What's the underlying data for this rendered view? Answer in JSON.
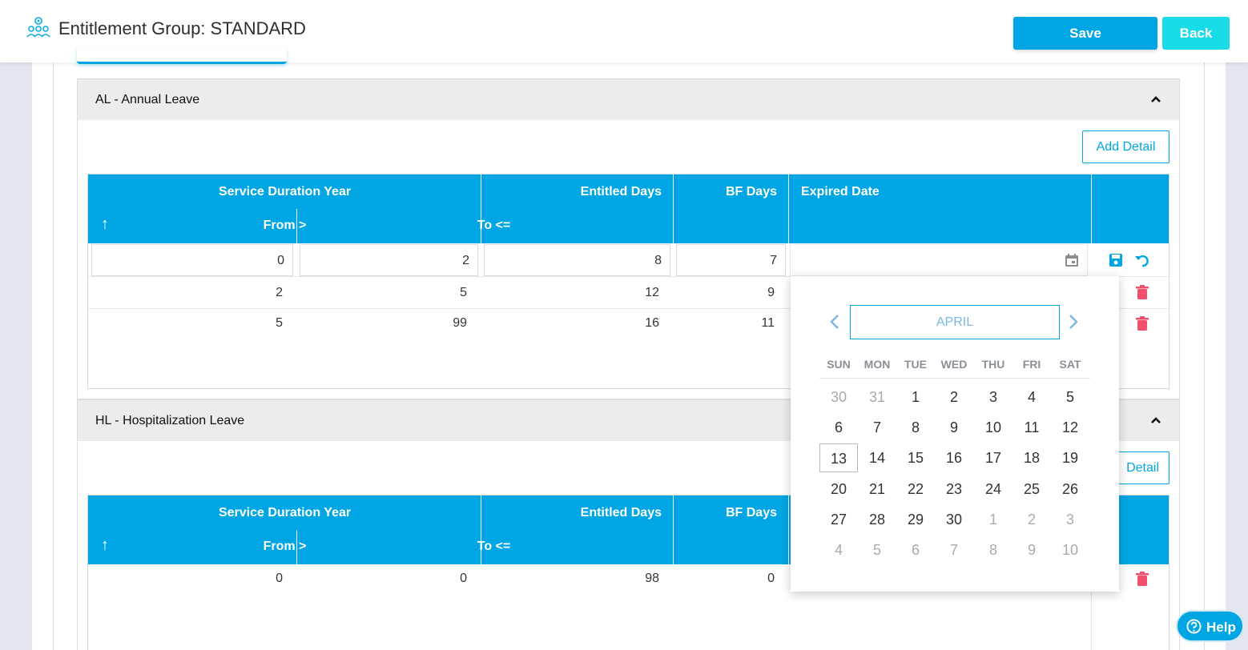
{
  "header": {
    "title": "Entitlement Group: STANDARD",
    "save_label": "Save",
    "back_label": "Back"
  },
  "colors": {
    "primary": "#00a6e3",
    "back": "#1adbe8",
    "danger": "#f0506e"
  },
  "tables": [
    {
      "title": "AL - Annual Leave",
      "add_label": "Add Detail",
      "headers": {
        "service": "Service Duration Year",
        "from": "From >",
        "to": "To <=",
        "entitled": "Entitled Days",
        "bf": "BF Days",
        "expired": "Expired Date",
        "sort": "↑"
      },
      "edit_row": {
        "from": "0",
        "to": "2",
        "entitled": "8",
        "bf": "7",
        "expired": ""
      },
      "rows": [
        {
          "from": "2",
          "to": "5",
          "entitled": "12",
          "bf": "9"
        },
        {
          "from": "5",
          "to": "99",
          "entitled": "16",
          "bf": "11"
        }
      ]
    },
    {
      "title": "HL - Hospitalization Leave",
      "add_label": "Detail",
      "headers": {
        "service": "Service Duration Year",
        "from": "From >",
        "to": "To <=",
        "entitled": "Entitled Days",
        "bf": "BF Days",
        "sort": "↑"
      },
      "rows": [
        {
          "from": "0",
          "to": "0",
          "entitled": "98",
          "bf": "0"
        }
      ]
    }
  ],
  "datepicker": {
    "month": "APRIL",
    "weekdays": [
      "SUN",
      "MON",
      "TUE",
      "WED",
      "THU",
      "FRI",
      "SAT"
    ],
    "weeks": [
      [
        "30",
        "31",
        "1",
        "2",
        "3",
        "4",
        "5"
      ],
      [
        "6",
        "7",
        "8",
        "9",
        "10",
        "11",
        "12"
      ],
      [
        "13",
        "14",
        "15",
        "16",
        "17",
        "18",
        "19"
      ],
      [
        "20",
        "21",
        "22",
        "23",
        "24",
        "25",
        "26"
      ],
      [
        "27",
        "28",
        "29",
        "30",
        "1",
        "2",
        "3"
      ],
      [
        "4",
        "5",
        "6",
        "7",
        "8",
        "9",
        "10"
      ]
    ],
    "today": "13"
  },
  "help_label": "Help"
}
